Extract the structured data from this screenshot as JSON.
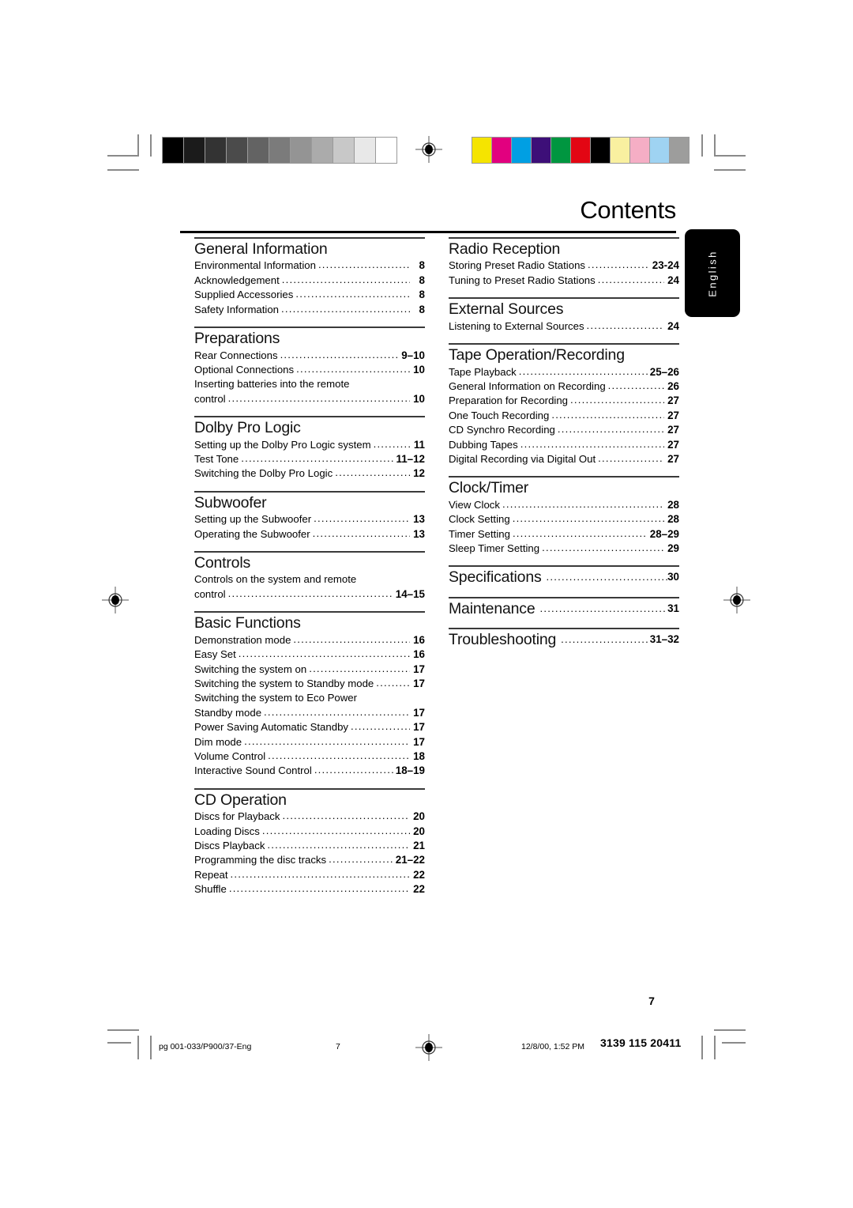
{
  "document": {
    "title": "Contents",
    "folio": "7",
    "language_tab": "English"
  },
  "calibration": {
    "gray_bar": {
      "name": "grayscale-step-wedge",
      "steps": [
        "#000000",
        "#1b1b1b",
        "#333333",
        "#4b4b4b",
        "#636363",
        "#7b7b7b",
        "#949494",
        "#ababab",
        "#c8c8c8",
        "#e8e8e8",
        "#ffffff"
      ]
    },
    "color_bar": {
      "name": "color-control-bar",
      "swatches": [
        "#f5e400",
        "#e2007f",
        "#009fe3",
        "#3d0f78",
        "#009640",
        "#e30613",
        "#000000",
        "#f9f0a0",
        "#f5aec5",
        "#9fd3f2",
        "#9d9d9c"
      ]
    }
  },
  "left_column": [
    {
      "heading": "General Information",
      "inline_page": null,
      "entries": [
        {
          "title": "Environmental Information",
          "page": "8"
        },
        {
          "title": "Acknowledgement",
          "page": "8"
        },
        {
          "title": "Supplied Accessories",
          "page": "8"
        },
        {
          "title": "Safety Information",
          "page": "8"
        }
      ]
    },
    {
      "heading": "Preparations",
      "inline_page": null,
      "entries": [
        {
          "title": "Rear Connections",
          "page": "9–10"
        },
        {
          "title": "Optional Connections",
          "page": "10"
        },
        {
          "title": "Inserting batteries into the remote",
          "page": "",
          "nodots": true
        },
        {
          "title": "control",
          "page": "10"
        }
      ]
    },
    {
      "heading": "Dolby Pro Logic",
      "inline_page": null,
      "entries": [
        {
          "title": "Setting up the Dolby Pro Logic system",
          "page": "11"
        },
        {
          "title": "Test Tone",
          "page": "11–12"
        },
        {
          "title": "Switching the Dolby Pro Logic",
          "page": "12"
        }
      ]
    },
    {
      "heading": "Subwoofer",
      "inline_page": null,
      "entries": [
        {
          "title": "Setting up the Subwoofer",
          "page": "13"
        },
        {
          "title": "Operating the Subwoofer",
          "page": "13"
        }
      ]
    },
    {
      "heading": "Controls",
      "inline_page": null,
      "entries": [
        {
          "title": "Controls on the system and remote",
          "page": "",
          "nodots": true
        },
        {
          "title": "control",
          "page": "14–15"
        }
      ]
    },
    {
      "heading": "Basic Functions",
      "inline_page": null,
      "entries": [
        {
          "title": "Demonstration mode",
          "page": "16"
        },
        {
          "title": "Easy Set",
          "page": "16"
        },
        {
          "title": "Switching the system on",
          "page": "17"
        },
        {
          "title": "Switching the system to Standby mode",
          "page": "17"
        },
        {
          "title": "Switching the system to Eco Power",
          "page": "",
          "nodots": true
        },
        {
          "title": "Standby mode",
          "page": "17"
        },
        {
          "title": "Power Saving Automatic Standby",
          "page": "17"
        },
        {
          "title": "Dim mode",
          "page": "17"
        },
        {
          "title": "Volume Control",
          "page": "18"
        },
        {
          "title": "Interactive Sound Control",
          "page": "18–19"
        }
      ]
    },
    {
      "heading": "CD Operation",
      "inline_page": null,
      "entries": [
        {
          "title": "Discs for Playback",
          "page": "20"
        },
        {
          "title": "Loading Discs",
          "page": "20"
        },
        {
          "title": "Discs Playback",
          "page": "21"
        },
        {
          "title": "Programming the disc tracks",
          "page": "21–22"
        },
        {
          "title": "Repeat",
          "page": "22"
        },
        {
          "title": "Shuffle",
          "page": "22"
        }
      ]
    }
  ],
  "right_column": [
    {
      "heading": "Radio Reception",
      "inline_page": null,
      "entries": [
        {
          "title": "Storing Preset Radio Stations",
          "page": "23-24"
        },
        {
          "title": "Tuning to Preset Radio Stations",
          "page": "24"
        }
      ]
    },
    {
      "heading": "External Sources",
      "inline_page": null,
      "entries": [
        {
          "title": "Listening to External Sources",
          "page": "24"
        }
      ]
    },
    {
      "heading": "Tape Operation/Recording",
      "inline_page": null,
      "entries": [
        {
          "title": "Tape Playback",
          "page": "25–26"
        },
        {
          "title": "General Information on Recording",
          "page": "26"
        },
        {
          "title": "Preparation for Recording",
          "page": "27"
        },
        {
          "title": "One Touch Recording",
          "page": "27"
        },
        {
          "title": "CD Synchro Recording",
          "page": "27"
        },
        {
          "title": "Dubbing Tapes",
          "page": "27"
        },
        {
          "title": "Digital Recording via Digital Out",
          "page": "27"
        }
      ]
    },
    {
      "heading": "Clock/Timer",
      "inline_page": null,
      "entries": [
        {
          "title": "View Clock",
          "page": "28"
        },
        {
          "title": "Clock Setting",
          "page": "28"
        },
        {
          "title": "Timer Setting",
          "page": "28–29"
        },
        {
          "title": "Sleep Timer Setting",
          "page": "29"
        }
      ]
    },
    {
      "heading": "Specifications",
      "inline_page": "30",
      "entries": []
    },
    {
      "heading": "Maintenance",
      "inline_page": "31",
      "entries": []
    },
    {
      "heading": "Troubleshooting",
      "inline_page": "31–32",
      "entries": []
    }
  ],
  "footer": {
    "file_name": "pg 001-033/P900/37-Eng",
    "page_number": "7",
    "timestamp": "12/8/00, 1:52 PM",
    "doc_code": "3139 115 20411"
  }
}
